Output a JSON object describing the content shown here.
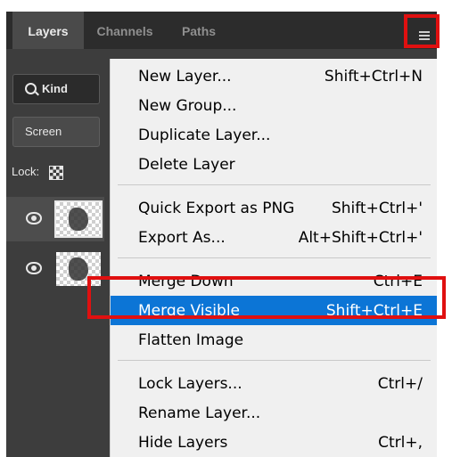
{
  "tabs": [
    {
      "label": "Layers",
      "active": true
    },
    {
      "label": "Channels",
      "active": false
    },
    {
      "label": "Paths",
      "active": false
    }
  ],
  "filter": {
    "kind_label": "Kind"
  },
  "blend_mode": "Screen",
  "lock": {
    "label": "Lock:"
  },
  "layers_menu": {
    "items": [
      {
        "label": "New Layer...",
        "shortcut": "Shift+Ctrl+N"
      },
      {
        "label": "New Group...",
        "shortcut": ""
      },
      {
        "label": "Duplicate Layer...",
        "shortcut": ""
      },
      {
        "label": "Delete Layer",
        "shortcut": ""
      },
      {
        "label": "Quick Export as PNG",
        "shortcut": "Shift+Ctrl+'"
      },
      {
        "label": "Export As...",
        "shortcut": "Alt+Shift+Ctrl+'"
      },
      {
        "label": "Merge Down",
        "shortcut": "Ctrl+E"
      },
      {
        "label": "Merge Visible",
        "shortcut": "Shift+Ctrl+E",
        "highlighted": true
      },
      {
        "label": "Flatten Image",
        "shortcut": ""
      },
      {
        "label": "Lock Layers...",
        "shortcut": "Ctrl+/"
      },
      {
        "label": "Rename Layer...",
        "shortcut": ""
      },
      {
        "label": "Hide Layers",
        "shortcut": "Ctrl+,"
      }
    ]
  },
  "icons": {
    "panel_menu": "hamburger-menu-icon",
    "search": "search-icon",
    "lock_transparency": "checkerboard-lock-icon",
    "visibility": "eye-icon"
  },
  "colors": {
    "highlight": "#0c75d6",
    "annotation": "#e01010",
    "panel": "#3d3d3d",
    "menu": "#f0f0f0"
  }
}
